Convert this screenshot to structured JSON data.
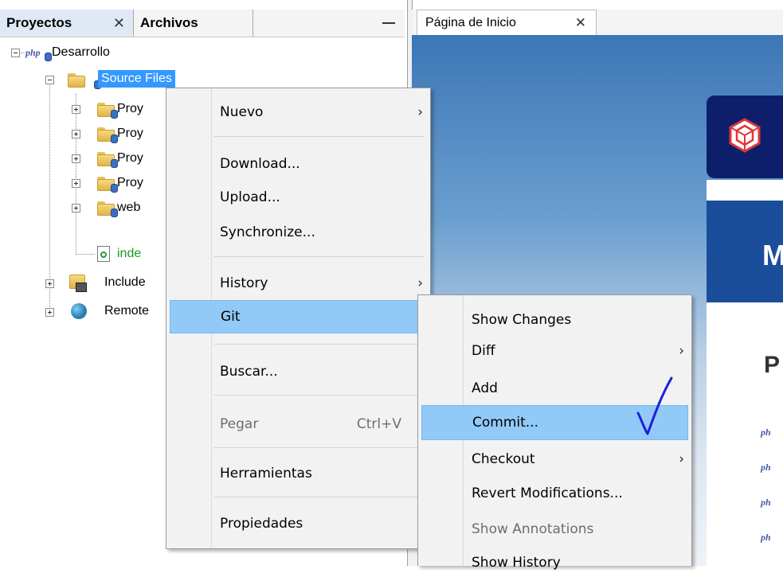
{
  "left_panel": {
    "tabs": [
      {
        "label": "Proyectos",
        "close": "✕"
      },
      {
        "label": "Archivos"
      }
    ],
    "tree": {
      "root": "Desarrollo",
      "root_logo": "php",
      "source_files": "Source Files",
      "children": [
        "Proy",
        "Proy",
        "Proy",
        "Proy",
        "web",
        "inde"
      ],
      "include": "Include",
      "remote": "Remote"
    }
  },
  "editor": {
    "tab_label": "Página de Inicio",
    "tab_close": "✕",
    "banner_letter": "M",
    "content_letter": "P",
    "php_labels": [
      "ph",
      "ph",
      "ph",
      "ph"
    ]
  },
  "context_menu": {
    "items": [
      {
        "label": "Nuevo",
        "arrow": "›"
      },
      {
        "label": "Download..."
      },
      {
        "label": "Upload..."
      },
      {
        "label": "Synchronize..."
      },
      {
        "label": "History",
        "arrow": "›"
      },
      {
        "label": "Git",
        "arrow": "›"
      },
      {
        "label": "Buscar..."
      },
      {
        "label": "Pegar",
        "accelerator": "Ctrl+V"
      },
      {
        "label": "Herramientas",
        "arrow": "›"
      },
      {
        "label": "Propiedades"
      }
    ]
  },
  "git_submenu": {
    "items": [
      {
        "label": "Show Changes"
      },
      {
        "label": "Diff",
        "arrow": "›"
      },
      {
        "label": "Add"
      },
      {
        "label": "Commit..."
      },
      {
        "label": "Checkout",
        "arrow": "›"
      },
      {
        "label": "Revert Modifications..."
      },
      {
        "label": "Show Annotations"
      },
      {
        "label": "Show History"
      }
    ]
  },
  "colors": {
    "menu_bg": "#f2f2f2",
    "highlight": "#91c9f7",
    "selection": "#3399ff",
    "annotation_mark": "#1f1fd6"
  }
}
